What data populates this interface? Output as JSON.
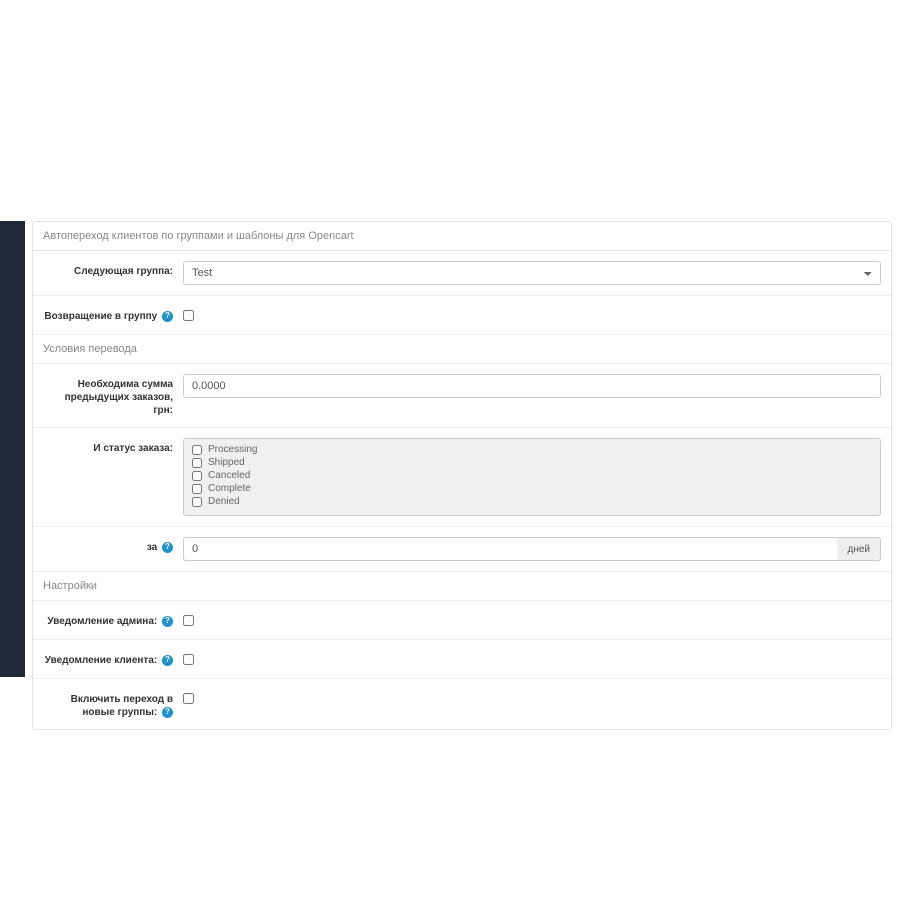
{
  "panel": {
    "title": "Автопереход клиентов по группами и шаблоны для Opencart"
  },
  "form": {
    "next_group_label": "Следующая группа:",
    "next_group_value": "Test",
    "return_group_label": "Возвращение в группу",
    "conditions_heading": "Условия перевода",
    "required_sum_label": "Необходима сумма предыдущих заказов, грн:",
    "required_sum_value": "0.0000",
    "order_status_label": "И статус заказа:",
    "statuses": [
      {
        "label": "Processing",
        "checked": false
      },
      {
        "label": "Shipped",
        "checked": false
      },
      {
        "label": "Canceled",
        "checked": false
      },
      {
        "label": "Complete",
        "checked": false
      },
      {
        "label": "Denied",
        "checked": false
      }
    ],
    "period_label": "за",
    "period_value": "0",
    "period_unit": "дней",
    "settings_heading": "Настройки",
    "admin_notify_label": "Уведомление админа:",
    "client_notify_label": "Уведомление клиента:",
    "enable_transition_label": "Включить переход в новые группы:"
  }
}
